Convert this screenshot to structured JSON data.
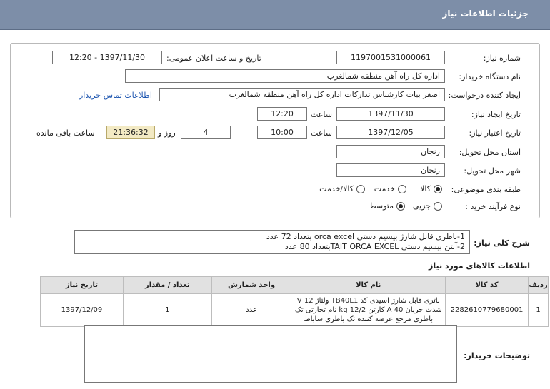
{
  "header": {
    "title": "جزئیات اطلاعات نیاز"
  },
  "form": {
    "need_number_label": "شماره نیاز:",
    "need_number": "1197001531000061",
    "announce_label": "تاریخ و ساعت اعلان عمومی:",
    "announce_value": "1397/11/30 - 12:20",
    "buyer_org_label": "نام دستگاه خریدار:",
    "buyer_org": "اداره کل راه آهن منطقه شمالغرب",
    "requester_label": "ایجاد کننده درخواست:",
    "requester": "اصغر بیات کارشناس تدارکات اداره کل راه آهن منطقه شمالغرب",
    "contact_link": "اطلاعات تماس خریدار",
    "created_date_label": "تاریخ ایجاد نیاز:",
    "created_date": "1397/11/30",
    "time_label": "ساعت",
    "created_time": "12:20",
    "valid_date_label": "تاریخ اعتبار نیاز:",
    "valid_date": "1397/12/05",
    "valid_time": "10:00",
    "days_label": "روز و",
    "days_value": "4",
    "remaining_time": "21:36:32",
    "remaining_label": "ساعت باقی مانده",
    "province_label": "استان محل تحویل:",
    "province": "زنجان",
    "city_label": "شهر محل تحویل:",
    "city": "زنجان",
    "category_label": "طبقه بندی موضوعی:",
    "category_options": [
      "کالا",
      "خدمت",
      "کالا/خدمت"
    ],
    "category_selected": "کالا",
    "process_label": "نوع فرآیند خرید :",
    "process_options": [
      "جزیی",
      "متوسط"
    ],
    "process_selected": "متوسط"
  },
  "description": {
    "label": "شرح کلی نیاز:",
    "line1": "1-باطری قابل شارژ بیسیم دستی orca excel بتعداد 72 عدد",
    "line2": "2-آنتن بیسیم دستی TAIT ORCA EXCELبتعداد 80 عدد"
  },
  "items": {
    "title": "اطلاعات کالاهای مورد نیاز",
    "headers": [
      "ردیف",
      "کد کالا",
      "نام کالا",
      "واحد شمارش",
      "تعداد / مقدار",
      "تاریخ نیاز"
    ],
    "rows": [
      {
        "row": "1",
        "code": "2282610779680001",
        "name": "باتری قابل شارژ اسیدی کد TB40L1 ولتاژ 12 V شدت جریان 40 A کارتن kg 12/2 نام تجارتی تک باطری مرجع عرضه کننده تک باطری ساباط",
        "unit": "عدد",
        "qty": "1",
        "date": "1397/12/09"
      }
    ]
  },
  "buyer_notes": {
    "label": "توضیحات خریدار:",
    "value": ""
  }
}
